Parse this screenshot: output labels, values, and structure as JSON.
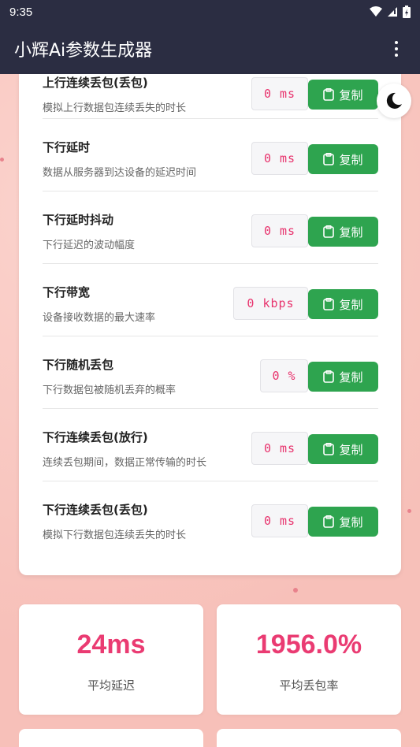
{
  "status_bar": {
    "time": "9:35"
  },
  "app_bar": {
    "title": "小辉Ai参数生成器"
  },
  "params": [
    {
      "title": "上行连续丢包(丢包)",
      "desc": "模拟上行数据包连续丢失的时长",
      "value": "0 ms",
      "copy": "复制"
    },
    {
      "title": "下行延时",
      "desc": "数据从服务器到达设备的延迟时间",
      "value": "0 ms",
      "copy": "复制"
    },
    {
      "title": "下行延时抖动",
      "desc": "下行延迟的波动幅度",
      "value": "0 ms",
      "copy": "复制"
    },
    {
      "title": "下行带宽",
      "desc": "设备接收数据的最大速率",
      "value": "0 kbps",
      "copy": "复制"
    },
    {
      "title": "下行随机丢包",
      "desc": "下行数据包被随机丢弃的概率",
      "value": "0 %",
      "copy": "复制"
    },
    {
      "title": "下行连续丢包(放行)",
      "desc": "连续丢包期间，数据正常传输的时长",
      "value": "0 ms",
      "copy": "复制"
    },
    {
      "title": "下行连续丢包(丢包)",
      "desc": "模拟下行数据包连续丢失的时长",
      "value": "0 ms",
      "copy": "复制"
    }
  ],
  "stats": [
    {
      "value": "24ms",
      "label": "平均延迟"
    },
    {
      "value": "1956.0%",
      "label": "平均丢包率"
    }
  ],
  "colors": {
    "app_bar": "#2b2d42",
    "accent": "#ea3b72",
    "copy_button": "#2ea44f",
    "background": "#f9c9c2"
  }
}
